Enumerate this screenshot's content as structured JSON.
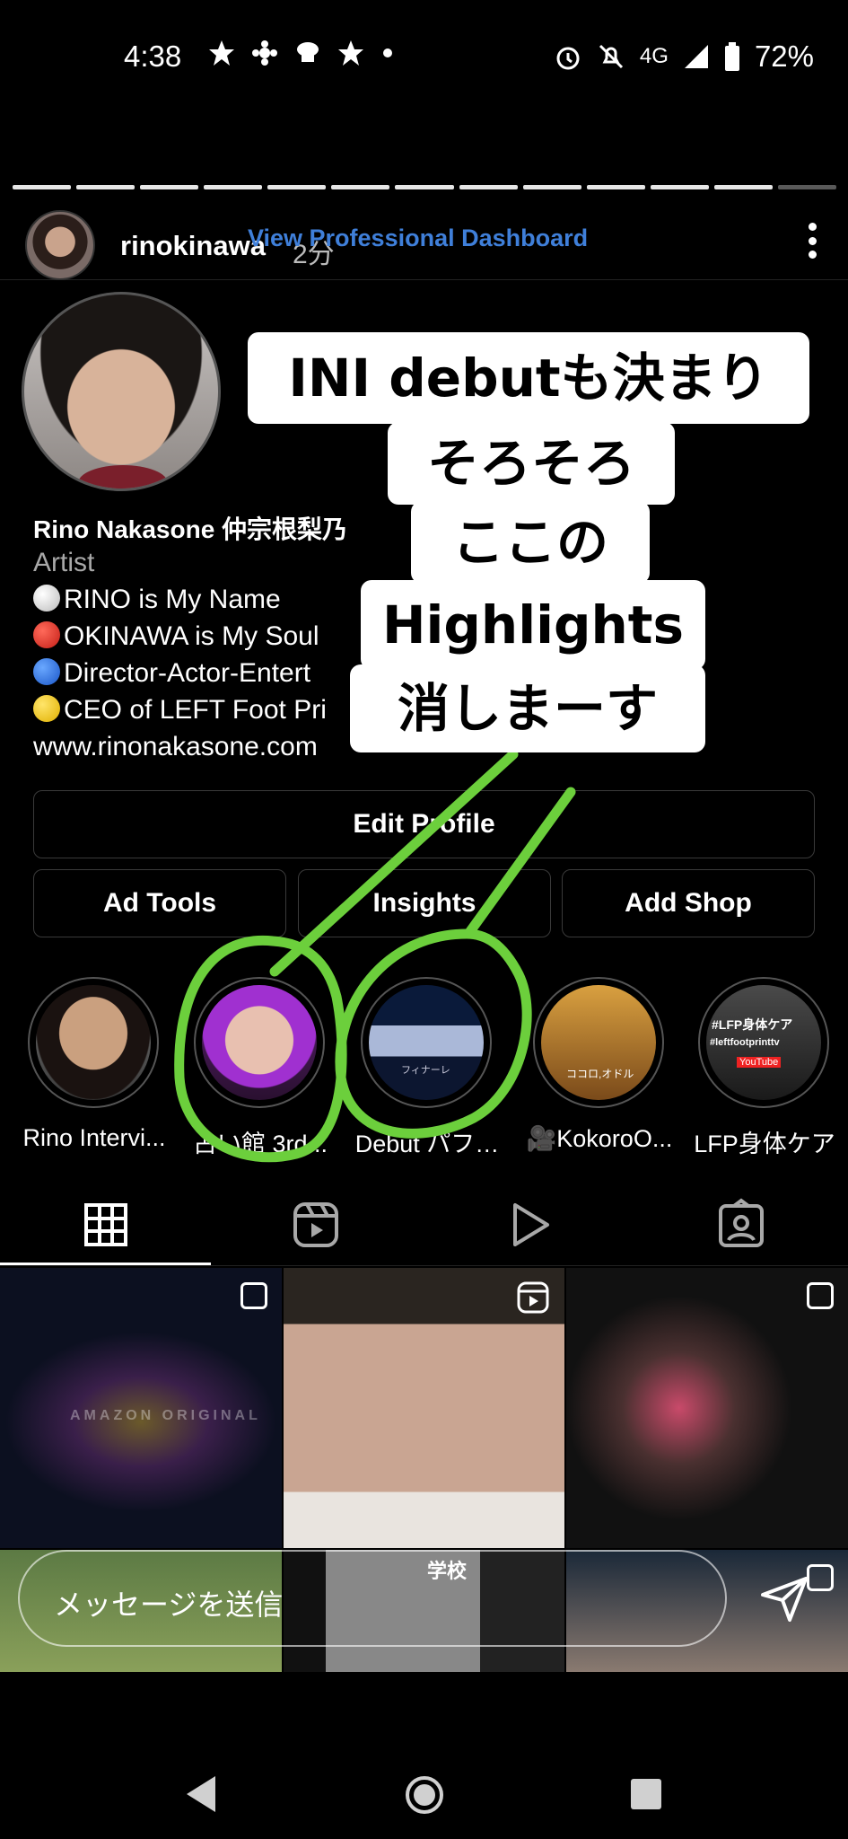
{
  "status_bar": {
    "time": "4:38",
    "network": "4G",
    "battery": "72%"
  },
  "story": {
    "username": "rinokinawa",
    "ago": "2分",
    "dashboard_link": "View Professional Dashboard",
    "segments_total": 13,
    "segments_viewed": 12
  },
  "profile": {
    "name": "Rino Nakasone 仲宗根梨乃",
    "category": "Artist",
    "bio": [
      "RINO is My Name",
      "OKINAWA is My Soul",
      "Director-Actor-Entert",
      "CEO of LEFT Foot Pri"
    ],
    "website": "www.rinonakasone.com"
  },
  "buttons": {
    "edit_profile": "Edit Profile",
    "ad_tools": "Ad Tools",
    "insights": "Insights",
    "add_shop": "Add Shop"
  },
  "highlights": [
    {
      "label": "Rino Intervi..."
    },
    {
      "label": "占い館 3rd..."
    },
    {
      "label": "Debut パフ…"
    },
    {
      "label": "🎥KokoroO..."
    },
    {
      "label": "LFP身体ケア"
    }
  ],
  "highlight_texts": {
    "lfp_line1": "#LFP身体ケア",
    "lfp_line2": "#leftfootprinttv",
    "lfp_line3": "YouTube",
    "debut_caption": "フィナーレ",
    "kokoro_caption": "ココロ,オドル"
  },
  "tabs": [
    "grid",
    "reels",
    "videos",
    "tagged"
  ],
  "grid": {
    "amazon_text": "AMAZON ORIGINAL",
    "school_sign": "学校"
  },
  "message_placeholder": "メッセージを送信",
  "annotation": {
    "lines": [
      "INI debutも決まり",
      "そろそろ",
      "ここの",
      "Highlights",
      "消しまーす"
    ],
    "stroke_color": "#6ccf3c"
  },
  "colors": {
    "link": "#3f7fd9",
    "background": "#000000"
  }
}
